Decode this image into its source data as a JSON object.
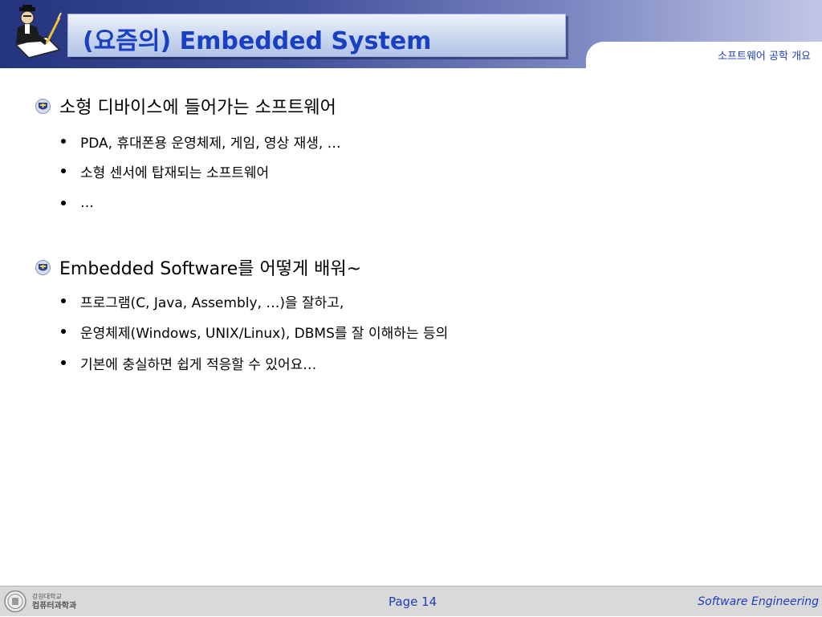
{
  "header": {
    "title": "(요즘의) Embedded System",
    "subtitle": "소프트웨어 공학 개요",
    "icon": "scholar-writing-icon",
    "colors": {
      "header_dark": "#24347e",
      "title_text": "#1a40c2",
      "link_blue": "#1d3fb7"
    }
  },
  "sections": [
    {
      "heading": "소형 디바이스에 들어가는 소프트웨어",
      "icon": "emblem-bullet-icon",
      "items": [
        "PDA, 휴대폰용 운영체제, 게임, 영상 재생, …",
        "소형 센서에 탑재되는 소프트웨어",
        "…"
      ]
    },
    {
      "heading": "Embedded Software를 어떻게 배워~",
      "icon": "emblem-bullet-icon",
      "items": [
        "프로그램(C, Java, Assembly, …)을 잘하고,",
        "운영체제(Windows, UNIX/Linux), DBMS를 잘 이해하는 등의",
        "기본에 충실하면 쉽게 적응할 수 있어요…"
      ]
    }
  ],
  "footer": {
    "university": "강원대학교",
    "department": "컴퓨터과학과",
    "page_label": "Page 14",
    "course": "Software Engineering"
  }
}
